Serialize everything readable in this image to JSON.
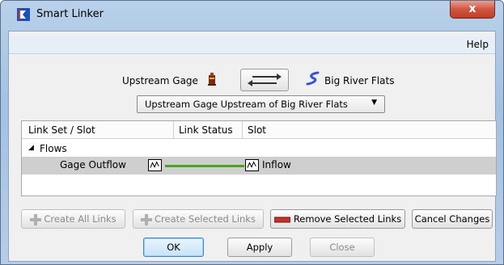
{
  "window": {
    "title": "Smart Linker",
    "close_glyph": "x"
  },
  "menu": {
    "help": "Help"
  },
  "upstream": {
    "label": "Upstream Gage",
    "icon": "gage-icon"
  },
  "swap": {
    "icon": "swap-arrows-icon"
  },
  "downstream": {
    "label": "Big River Flats",
    "icon": "reach-icon"
  },
  "link_set_select": {
    "selected": "Upstream Gage Upstream of Big River Flats"
  },
  "tree": {
    "columns": [
      "Link Set / Slot",
      "Link Status",
      "Slot"
    ],
    "group": {
      "label": "Flows",
      "expanded": true
    },
    "rows": [
      {
        "source_slot": "Gage Outflow",
        "dest_slot": "Inflow",
        "status_color": "#4aa51e"
      }
    ]
  },
  "buttons": {
    "create_all": "Create All Links",
    "create_selected": "Create Selected Links",
    "remove_selected": "Remove Selected Links",
    "cancel_changes": "Cancel Changes",
    "ok": "OK",
    "apply": "Apply",
    "close": "Close"
  },
  "colors": {
    "accent_red": "#c8302a",
    "link_green": "#4aa51e",
    "reach_blue": "#3450e0"
  }
}
